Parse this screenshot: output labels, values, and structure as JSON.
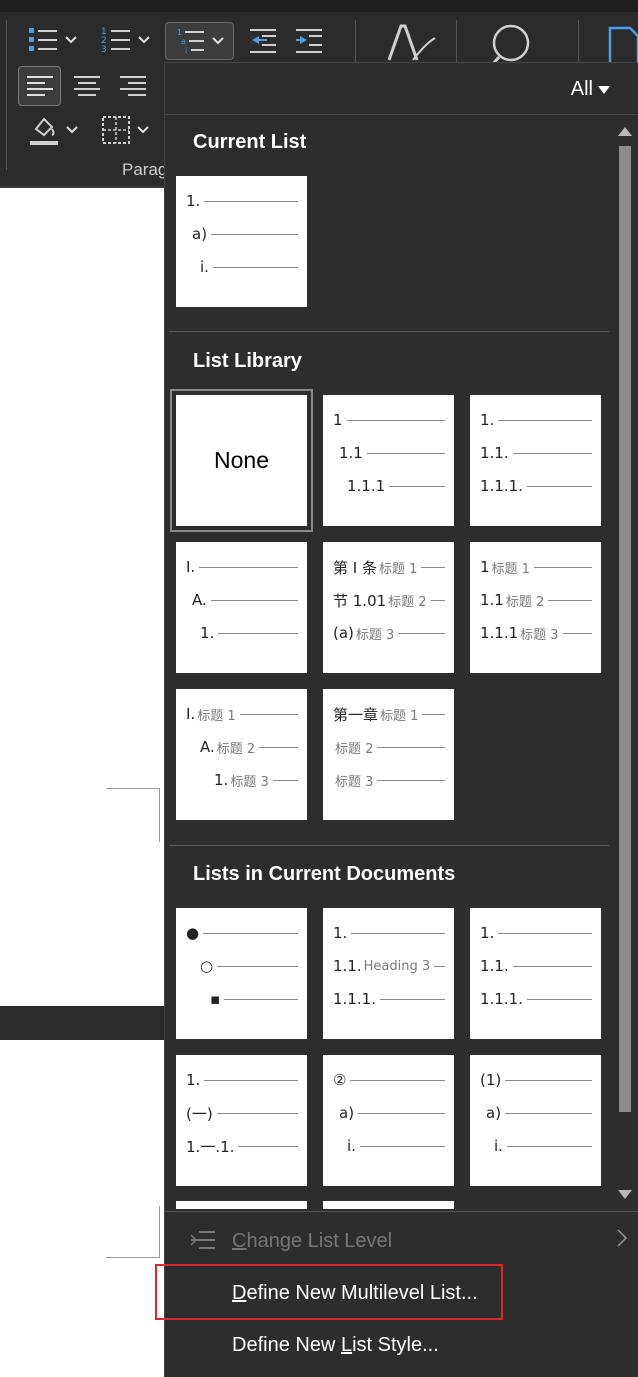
{
  "colors": {
    "ribbon_bg": "#2b2b2b",
    "panel_bg": "#2d2d2d",
    "accent_blue": "#4aa0e6",
    "highlight_red": "#e0262e"
  },
  "ribbon": {
    "group_label": "Parag",
    "icons": [
      "bullets-icon",
      "numbering-icon",
      "multilevel-list-icon",
      "decrease-indent-icon",
      "increase-indent-icon",
      "styles-icon",
      "search-icon",
      "align-left-icon",
      "center-icon",
      "align-right-icon",
      "shading-icon",
      "borders-icon"
    ]
  },
  "panel": {
    "filter_label": "All",
    "current_list": {
      "title": "Current List",
      "tiles": [
        {
          "rows": [
            {
              "label": "1."
            },
            {
              "label": "a)"
            },
            {
              "label": "i."
            }
          ]
        }
      ]
    },
    "list_library": {
      "title": "List Library",
      "none_label": "None",
      "tiles": [
        {
          "rows": [
            {
              "label": "1"
            },
            {
              "label": "1.1"
            },
            {
              "label": "1.1.1"
            }
          ]
        },
        {
          "rows": [
            {
              "label": "1."
            },
            {
              "label": "1.1."
            },
            {
              "label": "1.1.1."
            }
          ]
        },
        {
          "rows": [
            {
              "label": "I."
            },
            {
              "label": "A."
            },
            {
              "label": "1."
            }
          ]
        },
        {
          "rows": [
            {
              "label": "第 I 条",
              "heading": "标题 1"
            },
            {
              "label": "节 1.01",
              "heading": "标题 2"
            },
            {
              "label": "(a)",
              "heading": "标题 3"
            }
          ]
        },
        {
          "rows": [
            {
              "label": "1",
              "heading": "标题 1"
            },
            {
              "label": "1.1",
              "heading": "标题 2"
            },
            {
              "label": "1.1.1",
              "heading": "标题 3"
            }
          ]
        },
        {
          "rows": [
            {
              "label": "I.",
              "heading": "标题 1"
            },
            {
              "label": "A.",
              "heading": "标题 2"
            },
            {
              "label": "1.",
              "heading": "标题 3"
            }
          ]
        },
        {
          "rows": [
            {
              "label": "第一章",
              "heading": "标题 1"
            },
            {
              "label": "",
              "heading": "标题 2"
            },
            {
              "label": "",
              "heading": "标题 3"
            }
          ]
        }
      ]
    },
    "lists_in_current_documents": {
      "title": "Lists in Current Documents",
      "tiles": [
        {
          "rows": [
            {
              "label": "●"
            },
            {
              "label": "○"
            },
            {
              "label": "▪"
            }
          ]
        },
        {
          "rows": [
            {
              "label": "1."
            },
            {
              "label": "1.1.",
              "heading": "Heading 3"
            },
            {
              "label": "1.1.1."
            }
          ]
        },
        {
          "rows": [
            {
              "label": "1."
            },
            {
              "label": "1.1."
            },
            {
              "label": "1.1.1."
            }
          ]
        },
        {
          "rows": [
            {
              "label": "1."
            },
            {
              "label": "(一)"
            },
            {
              "label": "1.一.1."
            }
          ]
        },
        {
          "rows": [
            {
              "label": "②"
            },
            {
              "label": "a)"
            },
            {
              "label": "i."
            }
          ]
        },
        {
          "rows": [
            {
              "label": "(1)"
            },
            {
              "label": "a)"
            },
            {
              "label": "i."
            }
          ]
        }
      ]
    },
    "menu": {
      "change_level": "Change List Level",
      "define_multilevel": "Define New Multilevel List...",
      "define_style": "Define New List Style..."
    }
  }
}
